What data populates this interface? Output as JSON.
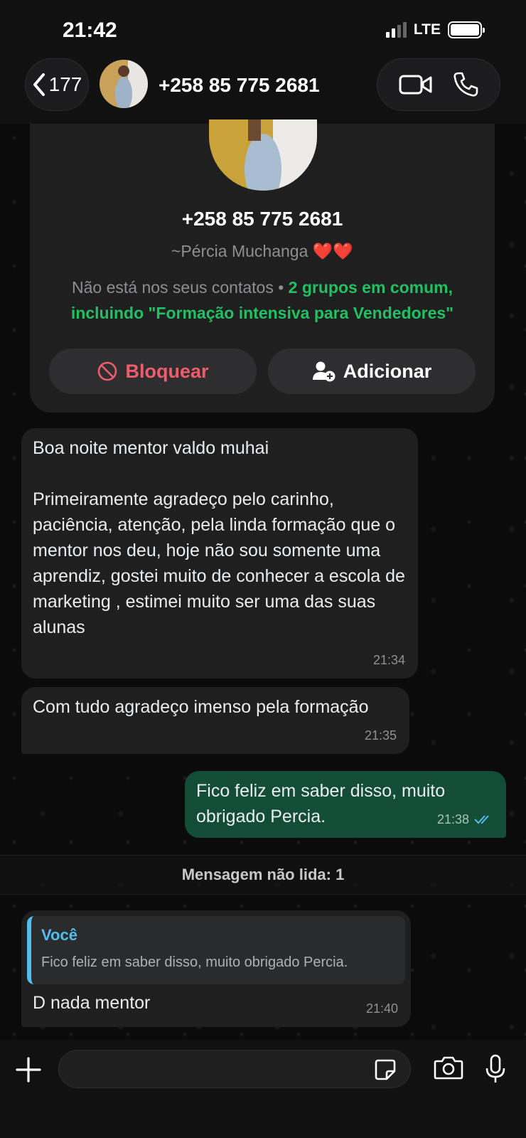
{
  "status": {
    "time": "21:42",
    "network": "LTE"
  },
  "header": {
    "back_count": "177",
    "title": "+258 85 775 2681"
  },
  "profile": {
    "phone": "+258 85 775 2681",
    "name": "~Pércia Muchanga",
    "hearts": "❤️❤️",
    "info_prefix": "Não está nos seus contatos • ",
    "info_highlight": "2 grupos em comum, incluindo \"Formação intensiva para Vendedores\"",
    "block_label": "Bloquear",
    "add_label": "Adicionar"
  },
  "messages": [
    {
      "direction": "in",
      "text": "Boa noite mentor valdo muhai\n\nPrimeiramente agradeço pelo carinho, paciência, atenção, pela linda formação que o mentor nos deu, hoje não sou somente uma aprendiz, gostei muito de conhecer a escola de marketing , estimei muito ser uma das suas alunas",
      "time": "21:34"
    },
    {
      "direction": "in",
      "text": "Com tudo agradeço imenso pela formação",
      "time": "21:35"
    },
    {
      "direction": "out",
      "text": "Fico feliz em saber disso, muito obrigado Percia.",
      "time": "21:38",
      "read": true
    },
    {
      "direction": "in",
      "quote_author": "Você",
      "quote_text": "Fico feliz em saber disso, muito obrigado Percia.",
      "text": "D nada mentor",
      "time": "21:40"
    }
  ],
  "unread_divider": "Mensagem não lida: 1",
  "colors": {
    "accent_green": "#21c063",
    "block_red": "#f15c6d",
    "outgoing_bubble": "#144d37",
    "quote_blue": "#53bdeb"
  },
  "icons": [
    "back-chevron-icon",
    "video-call-icon",
    "voice-call-icon",
    "block-icon",
    "add-contact-icon",
    "double-check-icon",
    "plus-icon",
    "sticker-icon",
    "camera-icon",
    "mic-icon"
  ]
}
